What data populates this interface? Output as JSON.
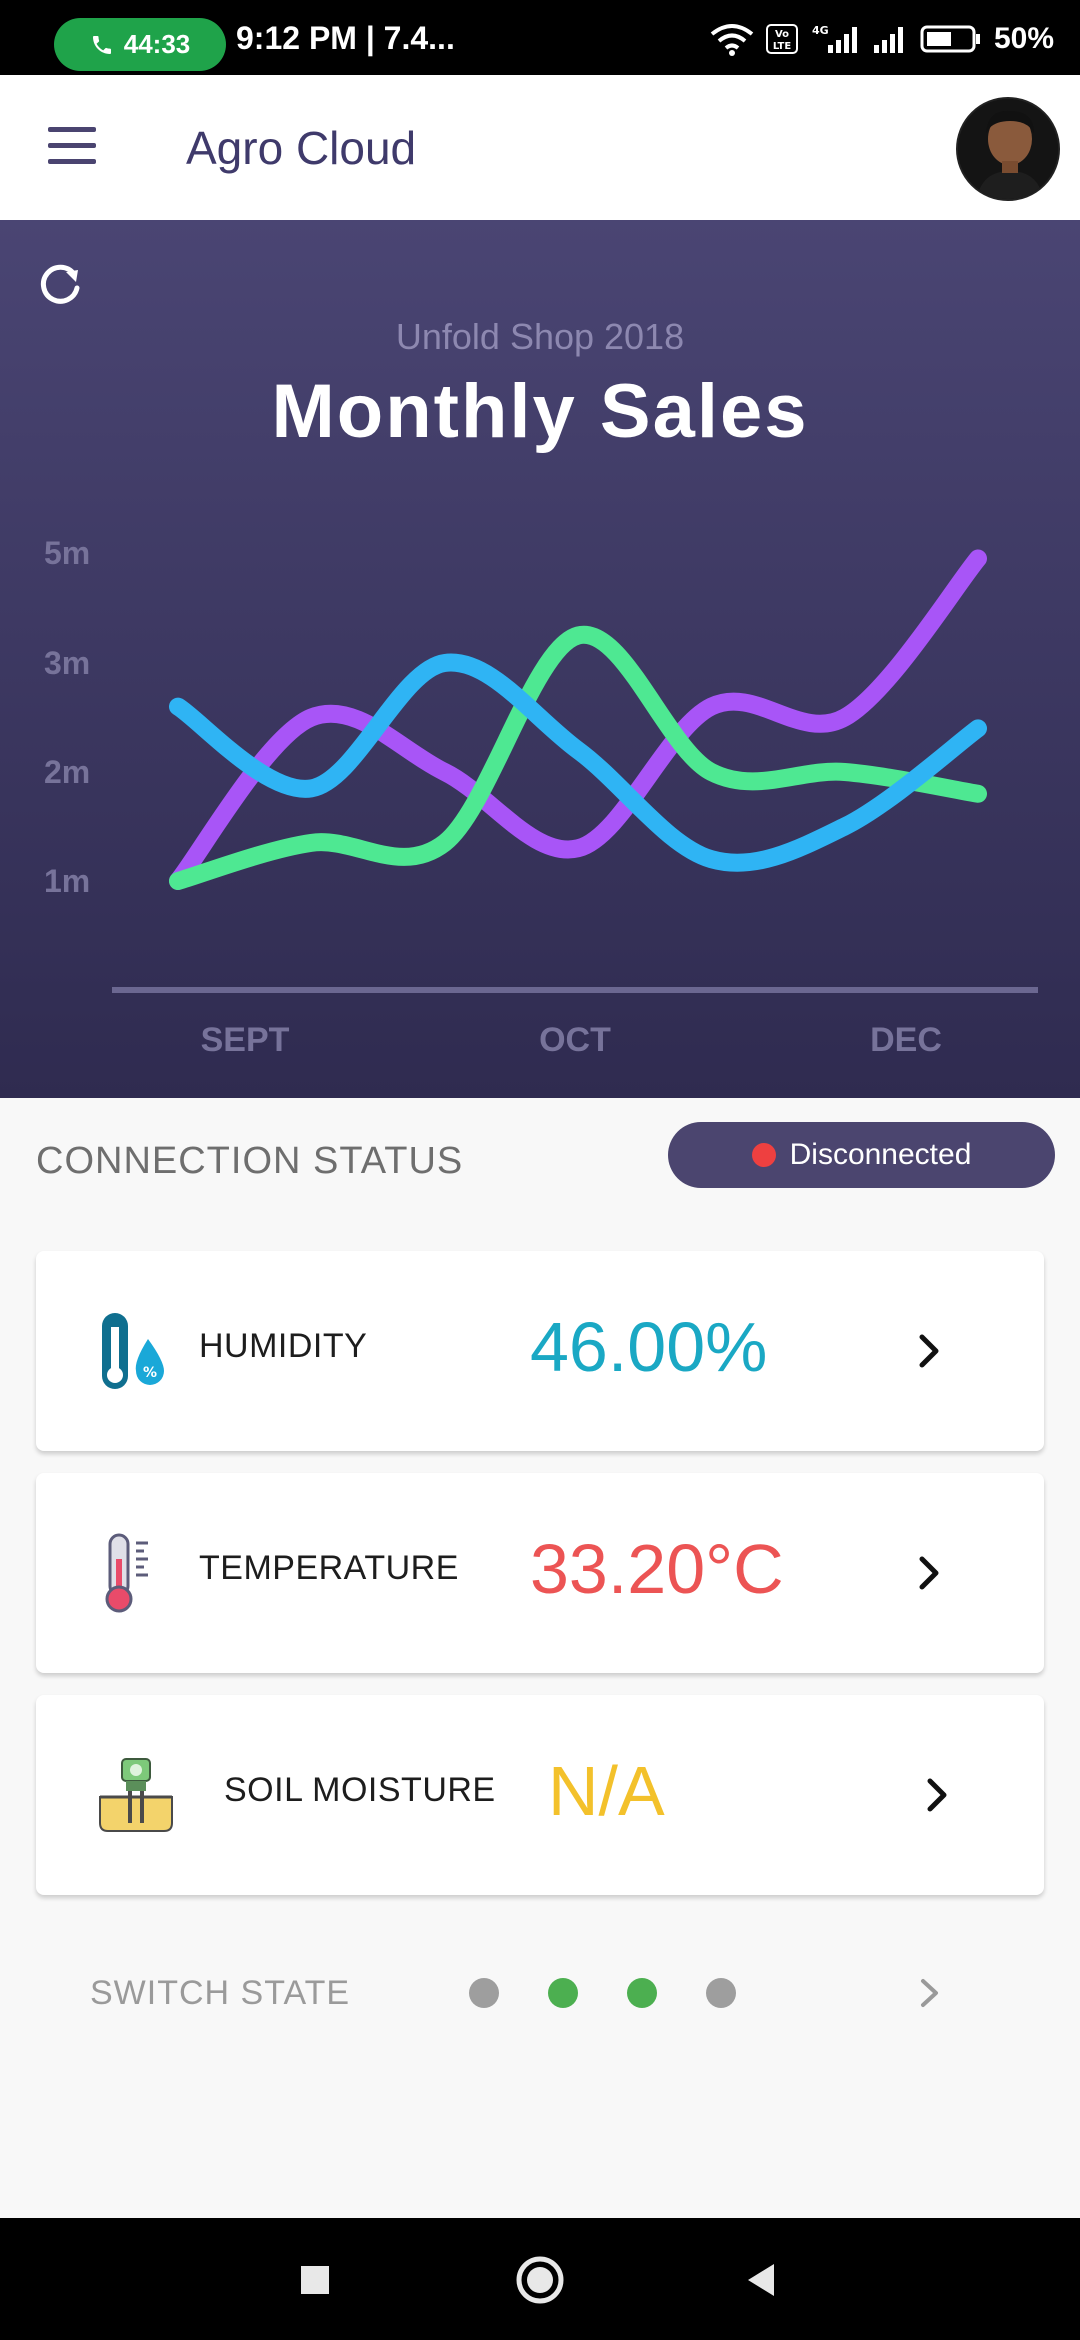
{
  "status_bar": {
    "call_timer": "44:33",
    "time_text": "9:12 PM |  7.4...",
    "battery": "50%",
    "icons": [
      "phone-icon",
      "wifi-icon",
      "volte-icon",
      "signal-icon",
      "signal-icon",
      "battery-icon"
    ]
  },
  "app_bar": {
    "title": "Agro Cloud",
    "menu_icon": "hamburger-menu-icon",
    "avatar": "user-avatar"
  },
  "chart": {
    "refresh_icon": "refresh-icon"
  },
  "chart_data": {
    "type": "line",
    "subtitle": "Unfold Shop 2018",
    "title": "Monthly Sales",
    "y_ticks": [
      "5m",
      "3m",
      "2m",
      "1m"
    ],
    "x_ticks": [
      "SEPT",
      "OCT",
      "DEC"
    ],
    "x": [
      0,
      1,
      2,
      3,
      4,
      5,
      6
    ],
    "series": [
      {
        "color": "#a855f7",
        "values": [
          1.0,
          2.5,
          2.0,
          1.3,
          2.6,
          2.5,
          4.9
        ]
      },
      {
        "color": "#4ee892",
        "values": [
          1.0,
          1.35,
          1.35,
          3.5,
          2.0,
          2.0,
          1.8
        ]
      },
      {
        "color": "#2fb4f4",
        "values": [
          2.6,
          1.85,
          3.0,
          2.2,
          1.2,
          1.5,
          2.4
        ]
      }
    ]
  },
  "connection": {
    "label": "CONNECTION  STATUS",
    "status": "Disconnected",
    "status_color": "#ee4040"
  },
  "sensors": [
    {
      "label": "HUMIDITY",
      "value": "46.00%",
      "color": "#1aa8c4",
      "icon": "humidity-icon"
    },
    {
      "label": "TEMPERATURE",
      "value": "33.20°C",
      "color": "#ec5454",
      "icon": "thermometer-icon"
    },
    {
      "label": "SOIL MOISTURE",
      "value": "N/A",
      "color": "#f3c12b",
      "icon": "soil-moisture-icon"
    }
  ],
  "switch_state": {
    "label": "SWITCH  STATE",
    "states": [
      {
        "on": false,
        "color": "#9e9e9e"
      },
      {
        "on": true,
        "color": "#4caf50"
      },
      {
        "on": true,
        "color": "#4caf50"
      },
      {
        "on": false,
        "color": "#9e9e9e"
      }
    ]
  },
  "nav_bar": {
    "icons": [
      "recents-square-icon",
      "home-circle-icon",
      "back-triangle-icon"
    ]
  }
}
